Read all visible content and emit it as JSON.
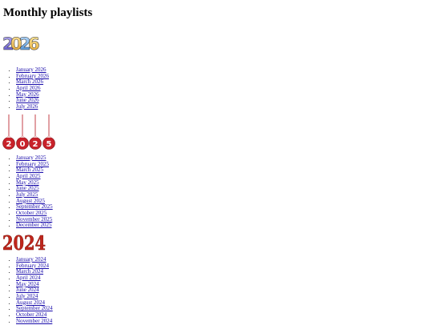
{
  "page": {
    "title": "Monthly playlists"
  },
  "years": [
    {
      "year": "2026",
      "months": [
        "January 2026",
        "February 2026",
        "March 2026",
        "April 2026",
        "May 2026",
        "June 2026",
        "July 2026"
      ]
    },
    {
      "year": "2025",
      "months": [
        "January 2025",
        "February 2025",
        "March 2025",
        "April 2025",
        "May 2025",
        "June 2025",
        "July 2025",
        "August 2025",
        "September 2025",
        "October 2025",
        "November 2025",
        "December 2025"
      ]
    },
    {
      "year": "2024",
      "months": [
        "January 2024",
        "February 2024",
        "March 2024",
        "April 2024",
        "May 2024",
        "June 2024",
        "July 2024",
        "August 2024",
        "September 2024",
        "October 2024",
        "November 2024"
      ]
    }
  ],
  "colors": {
    "link": "#1a0dab",
    "balloon_2026": [
      "#7b6fd6",
      "#e8b04a",
      "#6fa8e0",
      "#f2c04c"
    ],
    "ornament_2025": "#c8222a",
    "text_2024": "#c0261c"
  }
}
